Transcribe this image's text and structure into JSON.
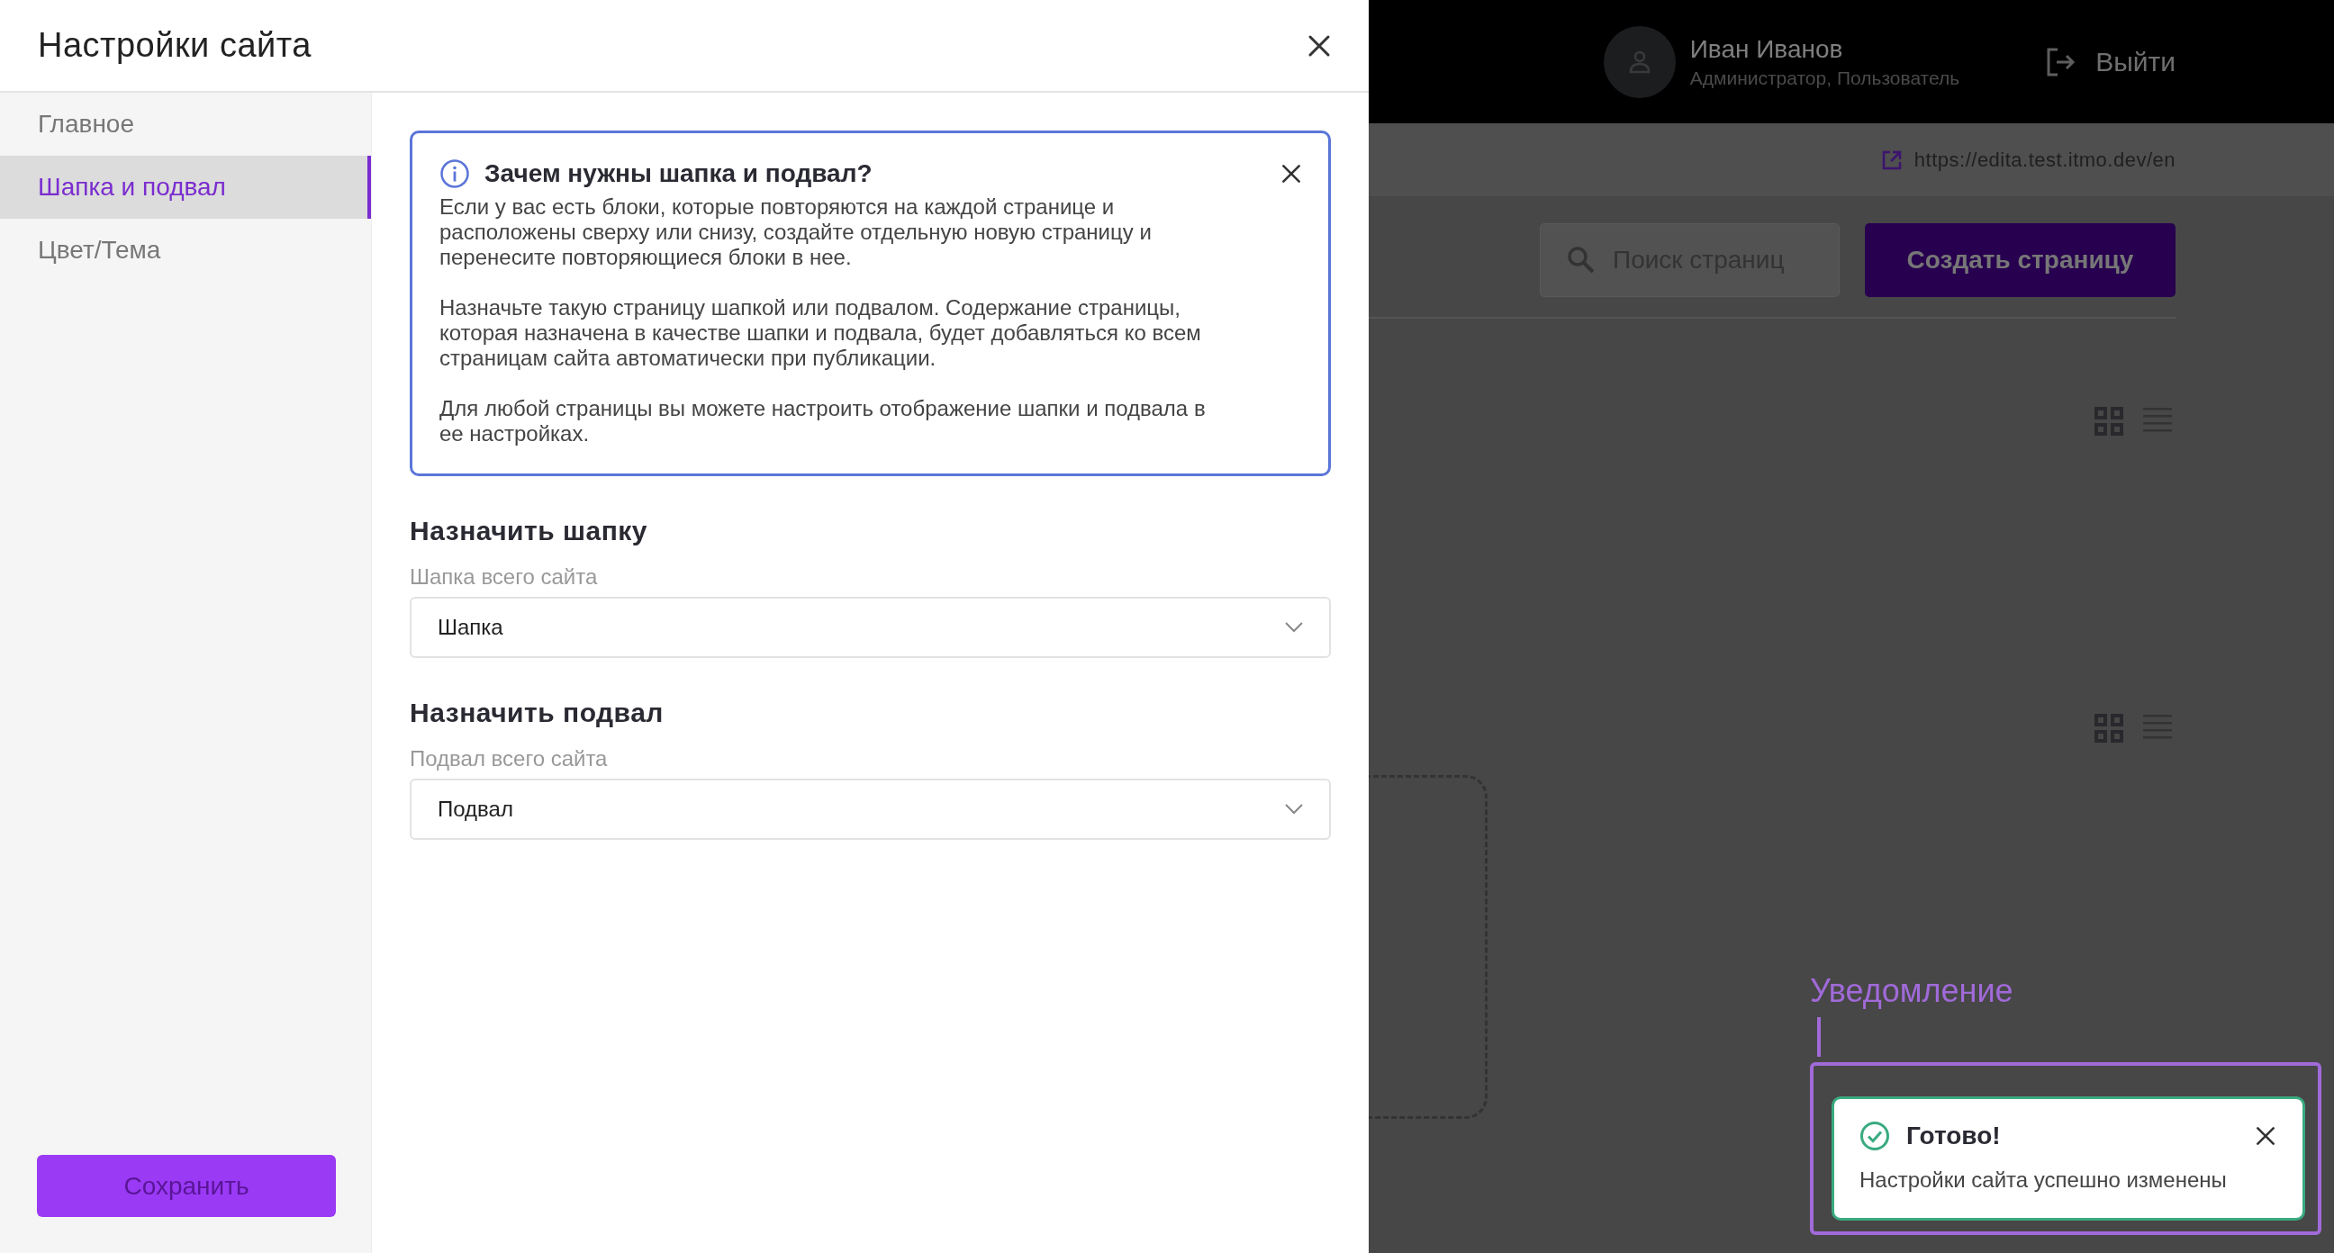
{
  "modal": {
    "title": "Настройки сайта",
    "nav": [
      {
        "label": "Главное",
        "selected": false
      },
      {
        "label": "Шапка и подвал",
        "selected": true
      },
      {
        "label": "Цвет/Тема",
        "selected": false
      }
    ],
    "save_button": {
      "label": "Сохранить",
      "disabled": true
    },
    "info": {
      "title": "Зачем нужны шапка и подвал?",
      "paragraphs": [
        "Если у вас есть блоки, которые повторяются на каждой странице и расположены сверху или снизу, создайте отдельную новую страницу и перенесите повторяющиеся блоки в нее.",
        "Назначьте такую страницу шапкой или подвалом. Содержание страницы, которая назначена в качестве шапки и подвала, будет добавляться ко всем страницам сайта автоматически при публикации.",
        "Для любой страницы вы можете настроить отображение шапки и подвала в ее настройках."
      ]
    },
    "sections": [
      {
        "heading": "Назначить шапку",
        "field_label": "Шапка всего сайта",
        "value": "Шапка"
      },
      {
        "heading": "Назначить подвал",
        "field_label": "Подвал всего сайта",
        "value": "Подвал"
      }
    ]
  },
  "background": {
    "user": {
      "name": "Иван Иванов",
      "roles": "Администратор, Пользователь"
    },
    "logout": "Выйти",
    "url": "https://edita.test.itmo.dev/en",
    "search": {
      "placeholder": "Поиск страниц"
    },
    "create_button": "Создать страницу"
  },
  "annotation": {
    "label": "Уведомление"
  },
  "toast": {
    "title": "Готово!",
    "message": "Настройки сайта успешно изменены"
  }
}
